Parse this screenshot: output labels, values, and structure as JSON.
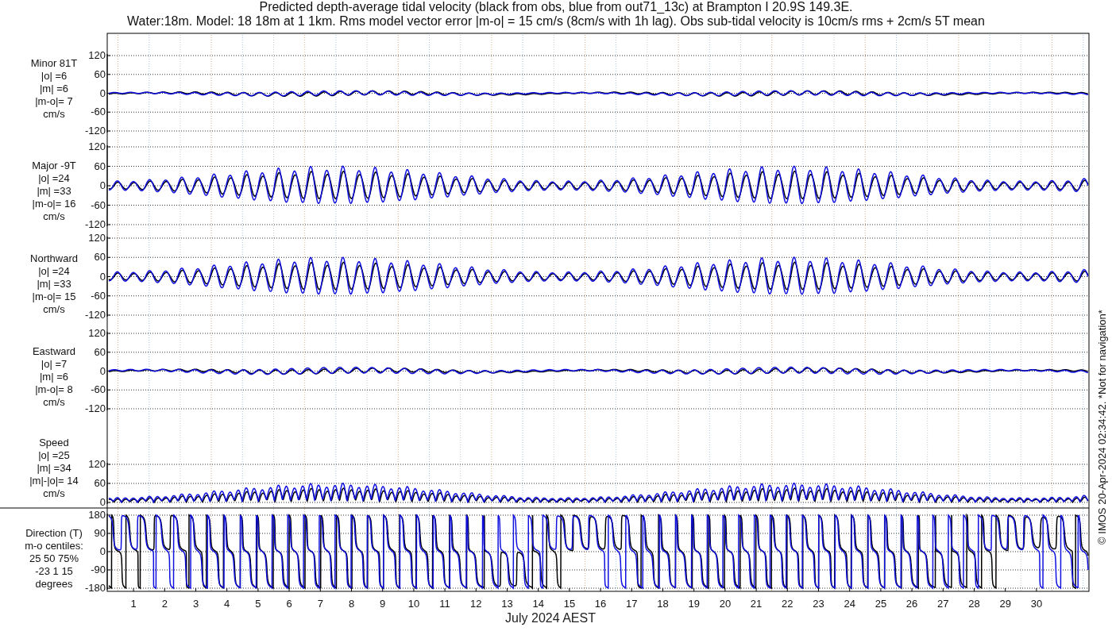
{
  "title": [
    "Predicted depth-average tidal velocity (black from obs, blue from out71_13c) at Brampton I 20.9S 149.3E.",
    "Water:18m. Model: 18 18m at 1 1km. Rms model vector error |m-o| = 15 cm/s (8cm/s with 1h lag). Obs sub-tidal velocity is 10cm/s rms + 2cm/s 5T mean"
  ],
  "panels": [
    {
      "kind": "minor",
      "label": [
        "Minor 81T",
        "|o| =6",
        "|m| =6",
        "|m-o|= 7",
        "cm/s"
      ],
      "yticks": [
        "120",
        "60",
        "0",
        "-60",
        "-120"
      ]
    },
    {
      "kind": "major",
      "label": [
        "Major -9T",
        "|o| =24",
        "|m| =33",
        "|m-o|= 16",
        "cm/s"
      ],
      "yticks": [
        "120",
        "60",
        "0",
        "-60",
        "-120"
      ]
    },
    {
      "kind": "northward",
      "label": [
        "Northward",
        "|o| =24",
        "|m| =33",
        "|m-o|= 15",
        "cm/s"
      ],
      "yticks": [
        "120",
        "60",
        "0",
        "-60",
        "-120"
      ]
    },
    {
      "kind": "eastward",
      "label": [
        "Eastward",
        "|o| =7",
        "|m| =6",
        "|m-o|= 8",
        "cm/s"
      ],
      "yticks": [
        "120",
        "60",
        "0",
        "-60",
        "-120"
      ]
    },
    {
      "kind": "speed",
      "label": [
        "Speed",
        "|o| =25",
        "|m| =34",
        "|m|-|o|= 14",
        "cm/s"
      ],
      "yticks": [
        "120",
        "60",
        "0"
      ]
    },
    {
      "kind": "direction",
      "label": [
        "Direction (T)",
        "m-o centiles:",
        "25  50  75%",
        "-23   1  15",
        "degrees"
      ],
      "yticks": [
        "180",
        "90",
        "0",
        "-90",
        "-180"
      ]
    }
  ],
  "xaxis": {
    "ticks": [
      "1",
      "2",
      "3",
      "4",
      "5",
      "6",
      "7",
      "8",
      "9",
      "10",
      "11",
      "12",
      "13",
      "14",
      "15",
      "16",
      "17",
      "18",
      "19",
      "20",
      "21",
      "22",
      "23",
      "24",
      "25",
      "26",
      "27",
      "28",
      "29",
      "30"
    ],
    "label": "July 2024 AEST"
  },
  "credit": "© IMOS 20-Apr-2024 02:34:42. *Not for navigation*"
}
